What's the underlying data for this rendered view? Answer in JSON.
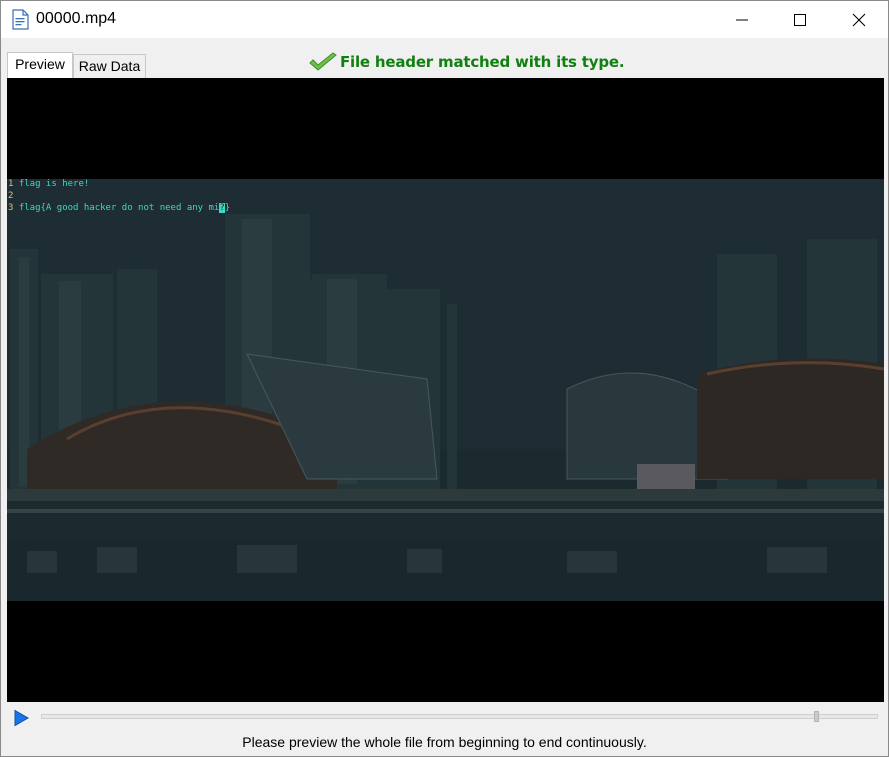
{
  "window": {
    "title": "00000.mp4"
  },
  "tabs": [
    {
      "label": "Preview",
      "selected": true
    },
    {
      "label": "Raw Data",
      "selected": false
    }
  ],
  "status": {
    "message": "File header matched with its type.",
    "color": "#108010",
    "icon": "checkmark-icon"
  },
  "video": {
    "code_lines": [
      {
        "num": "1",
        "text": "flag is here!"
      },
      {
        "num": "2",
        "text": ""
      },
      {
        "num": "3",
        "text": "flag{A good hacker do not need any mi",
        "cursor_char": "?",
        "after_cursor": "}"
      }
    ],
    "playback_position": 0.97
  },
  "footer": {
    "hint": "Please preview the whole file from beginning to end continuously."
  },
  "colors": {
    "accent": "#1a73e8",
    "code_text": "#3dd9c4",
    "line_numbers": "#d8c470"
  }
}
